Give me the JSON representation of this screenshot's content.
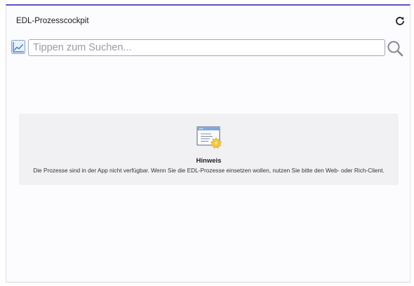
{
  "header": {
    "title": "EDL-Prozesscockpit",
    "refresh_icon": "refresh-icon"
  },
  "toolbar": {
    "chart_icon": "line-chart-icon",
    "search_placeholder": "Tippen zum Suchen...",
    "search_value": "",
    "search_icon": "search-icon"
  },
  "notice": {
    "icon": "settings-document-icon",
    "title": "Hinweis",
    "message": "Die Prozesse sind in der App nicht verfügbar. Wenn Sie die EDL-Prozesse einsetzen wollen, nutzen Sie bitte den Web- oder Rich-Client."
  },
  "colors": {
    "accent": "#5a54c0",
    "notice_background": "#f1f0f3",
    "icon_blue": "#3c7fd1",
    "icon_yellow": "#f5c53d"
  }
}
